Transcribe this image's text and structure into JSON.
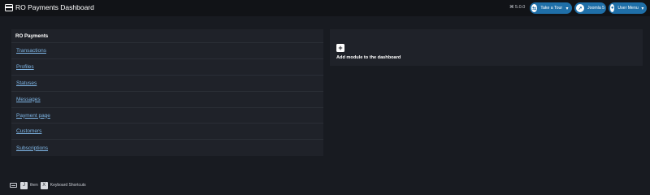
{
  "header": {
    "title": "RO Payments Dashboard",
    "version": "⌘ 5.0.0",
    "tour_label": "Take a Tour",
    "site_label": "Joomla 5",
    "user_label": "User Menu",
    "logo_icon": "logo-icon",
    "tour_icon": "signpost-icon",
    "site_icon": "external-link-icon",
    "user_icon": "user-icon",
    "accent": "#1f6fa8"
  },
  "module": {
    "title": "RO Payments",
    "links": [
      {
        "label": "Transactions"
      },
      {
        "label": "Profiles"
      },
      {
        "label": "Statuses"
      },
      {
        "label": "Messages"
      },
      {
        "label": "Payment page"
      },
      {
        "label": "Customers"
      },
      {
        "label": "Subscriptions"
      }
    ]
  },
  "add_module": {
    "plus": "+",
    "label": "Add module to the dashboard"
  },
  "footer": {
    "key1": "J",
    "then": "then",
    "key2": "X",
    "text": "Keyboard Shortcuts"
  }
}
